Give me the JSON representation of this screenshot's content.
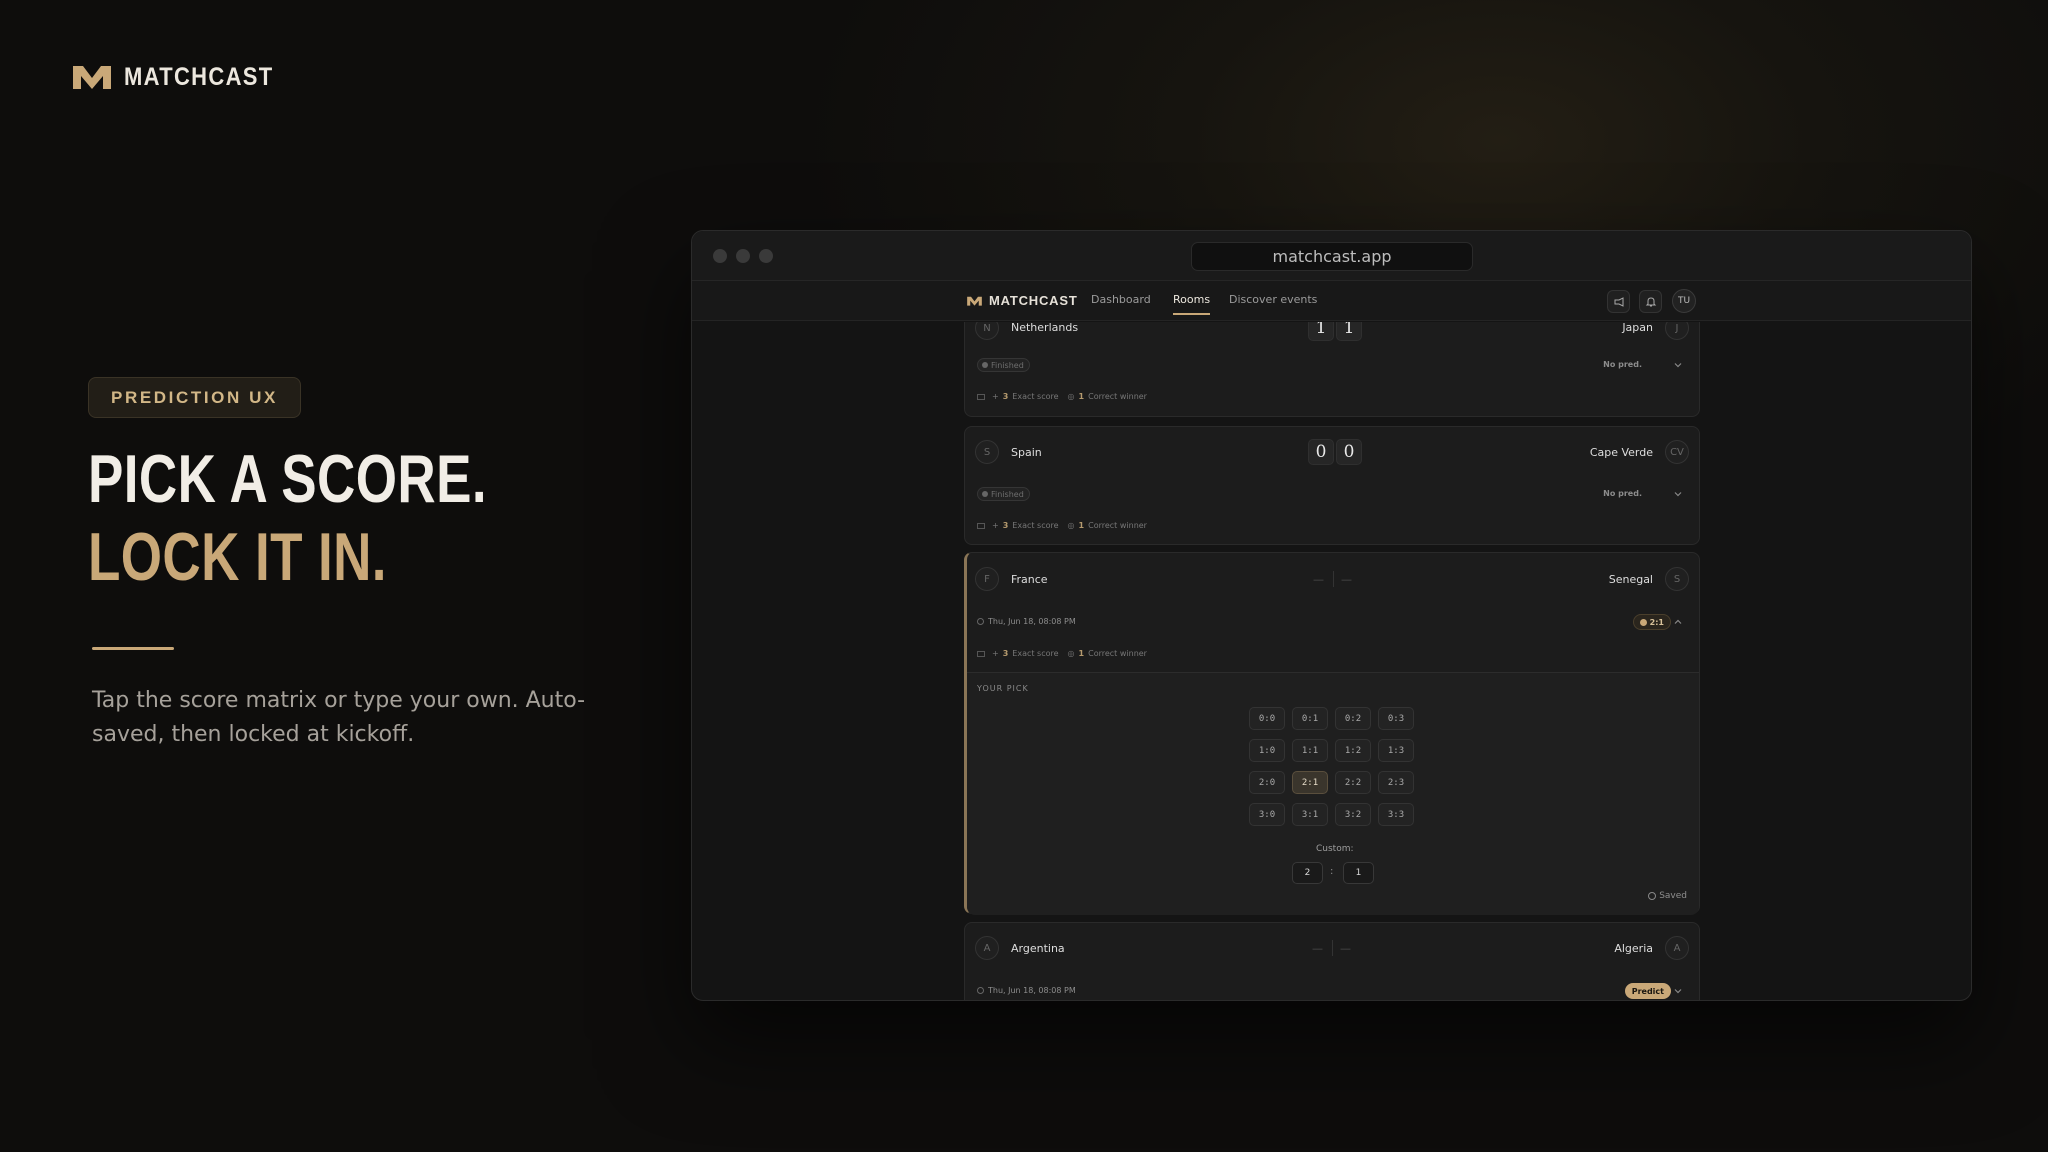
{
  "brand": {
    "name": "MATCHCAST"
  },
  "hero": {
    "tag": "PREDICTION UX",
    "headline_line1": "PICK A SCORE.",
    "headline_line2": "LOCK IT IN.",
    "subcopy": "Tap the score matrix or type your own. Auto-saved, then locked at kickoff."
  },
  "colors": {
    "accent": "#c9a878",
    "background": "#0e0d0c",
    "card": "#1c1c1c"
  },
  "browser": {
    "url": "matchcast.app"
  },
  "app_nav": {
    "logo": "MATCHCAST",
    "links": [
      "Dashboard",
      "Rooms",
      "Discover events"
    ],
    "active": "Rooms",
    "icons": [
      "megaphone-icon",
      "bell-icon"
    ],
    "avatar": "TU"
  },
  "matches": [
    {
      "home": "Netherlands",
      "home_initial": "N",
      "away": "Japan",
      "away_initial": "J",
      "home_score": "1",
      "away_score": "1",
      "status": "Finished",
      "prediction": "No pred.",
      "exact_pts": "3",
      "exact_label": "Exact score",
      "winner_pts": "1",
      "winner_label": "Correct winner"
    },
    {
      "home": "Spain",
      "home_initial": "S",
      "away": "Cape Verde",
      "away_initial": "CV",
      "home_score": "0",
      "away_score": "0",
      "status": "Finished",
      "prediction": "No pred.",
      "exact_pts": "3",
      "exact_label": "Exact score",
      "winner_pts": "1",
      "winner_label": "Correct winner"
    },
    {
      "home": "France",
      "home_initial": "F",
      "away": "Senegal",
      "away_initial": "S",
      "home_score": "—",
      "away_score": "—",
      "kickoff": "Thu, Jun 18, 08:08 PM",
      "prediction": "2:1",
      "exact_pts": "3",
      "exact_label": "Exact score",
      "winner_pts": "1",
      "winner_label": "Correct winner",
      "pick": {
        "title": "YOUR PICK",
        "grid": [
          [
            "0:0",
            "0:1",
            "0:2",
            "0:3"
          ],
          [
            "1:0",
            "1:1",
            "1:2",
            "1:3"
          ],
          [
            "2:0",
            "2:1",
            "2:2",
            "2:3"
          ],
          [
            "3:0",
            "3:1",
            "3:2",
            "3:3"
          ]
        ],
        "selected": "2:1",
        "custom_label": "Custom:",
        "custom_home": "2",
        "custom_away": "1",
        "saved_label": "Saved"
      }
    },
    {
      "home": "Argentina",
      "home_initial": "A",
      "away": "Algeria",
      "away_initial": "A",
      "home_score": "—",
      "away_score": "—",
      "kickoff": "Thu, Jun 18, 08:08 PM",
      "action": "Predict"
    }
  ]
}
